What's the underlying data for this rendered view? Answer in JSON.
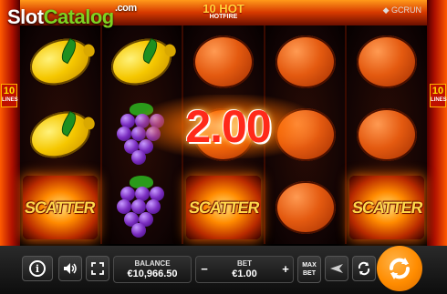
{
  "watermark": {
    "part1": "Slot",
    "part2": "Catalog",
    "suffix": ".com"
  },
  "game": {
    "title": "10 HOT",
    "subtitle": "HOTFIRE"
  },
  "brand": "◆ GCRUN",
  "paylines": {
    "count": "10",
    "label": "LINES"
  },
  "reels": [
    [
      "lemon",
      "lemon",
      "scatter"
    ],
    [
      "lemon",
      "grapes",
      "grapes"
    ],
    [
      "orange",
      "orange",
      "scatter"
    ],
    [
      "orange",
      "orange",
      "orange"
    ],
    [
      "orange",
      "orange",
      "scatter"
    ]
  ],
  "scatter_text": "SCATTER",
  "win_amount": "2.00",
  "balance": {
    "label": "BALANCE",
    "value": "€10,966.50"
  },
  "bet": {
    "label": "BET",
    "value": "€1.00",
    "minus": "−",
    "plus": "+"
  },
  "max_bet": {
    "line1": "MAX",
    "line2": "BET"
  },
  "info": "i",
  "icons": {
    "info": "info-icon",
    "sound": "speaker-icon",
    "fullscreen": "fullscreen-icon",
    "turbo": "turbo-icon",
    "autoplay": "autoplay-icon",
    "spin": "spin-icon"
  },
  "colors": {
    "spin": "#ff8c00",
    "accent": "#ffd23a",
    "win": "#ff2a1a"
  }
}
